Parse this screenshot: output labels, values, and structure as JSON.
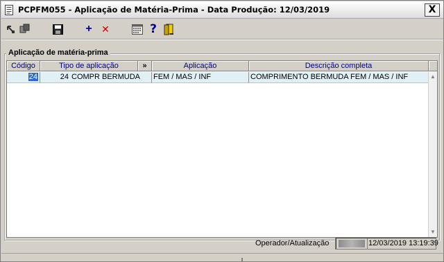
{
  "window": {
    "title": "PCPFM055 - Aplicação de Matéria-Prima - Data Produção: 12/03/2019",
    "close_label": "X"
  },
  "toolbar": {
    "buttons": [
      {
        "name": "export-icon"
      },
      {
        "name": "copy-icon"
      },
      {
        "name": "save-icon"
      },
      {
        "name": "add-icon",
        "label": "+"
      },
      {
        "name": "delete-icon",
        "label": "✕"
      },
      {
        "name": "calendar-icon"
      },
      {
        "name": "help-icon",
        "label": "?"
      },
      {
        "name": "exit-door-icon"
      }
    ],
    "colors": {
      "add": "#00008b",
      "delete": "#cc0000",
      "help": "#00008b"
    }
  },
  "group": {
    "label": "Aplicação de matéria-prima"
  },
  "grid": {
    "columns": [
      "Código",
      "Tipo de aplicação",
      "»",
      "Aplicação",
      "Descrição completa"
    ],
    "rows": [
      {
        "codigo": "24",
        "tipo_codigo": "24",
        "tipo_aplicacao": "COMPR BERMUDA",
        "aplicacao": "FEM / MAS / INF",
        "descricao": "COMPRIMENTO BERMUDA FEM / MAS / INF"
      }
    ],
    "scroll_up": "▲",
    "scroll_down": "▼"
  },
  "footer": {
    "label": "Operador/Atualização",
    "timestamp": "12/03/2019 13:19:39"
  }
}
